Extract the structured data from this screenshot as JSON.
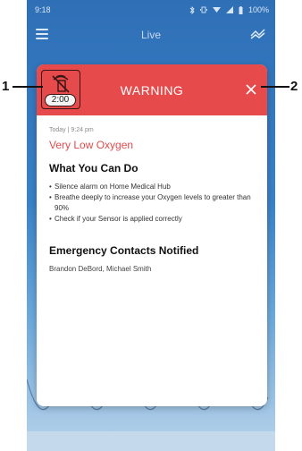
{
  "status_bar": {
    "time": "9:18",
    "battery": "100%"
  },
  "nav": {
    "title": "Live",
    "menu_icon": "menu-icon",
    "trend_icon": "trend-icon"
  },
  "alert": {
    "header_title": "WARNING",
    "countdown": "2:00",
    "timestamp": "Today | 9:24 pm",
    "title": "Very Low Oxygen",
    "section_title": "What You Can Do",
    "actions": [
      "Silence alarm on Home Medical Hub",
      "Breathe deeply to increase your Oxygen levels to greater than 90%",
      "Check if your Sensor is applied correctly"
    ],
    "contacts_title": "Emergency Contacts Notified",
    "contacts": "Brandon DeBord, Michael Smith"
  },
  "callouts": {
    "left": "1",
    "right": "2"
  },
  "colors": {
    "header": "#e64a4a",
    "alert_title": "#e64a4a",
    "background": "#2f6fb6"
  }
}
